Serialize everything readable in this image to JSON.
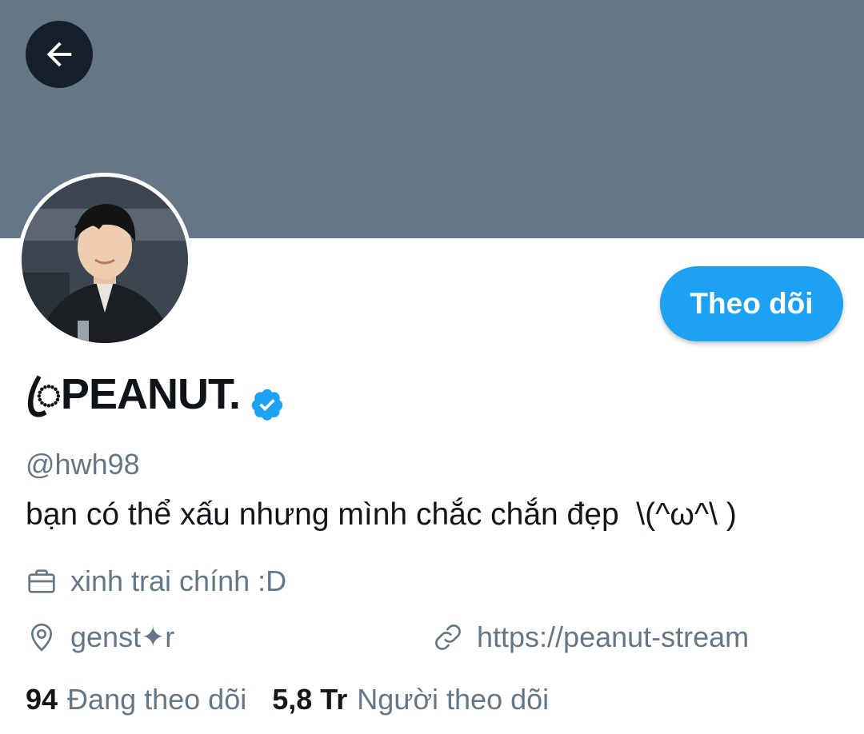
{
  "header": {
    "banner_color": "#657786",
    "back_icon": "arrow-left-icon"
  },
  "profile": {
    "display_name": "ꦿPEANUT.",
    "verified_icon": "verified-badge-icon",
    "handle": "@hwh98",
    "bio": "bạn có thể xấu nhưng mình chắc chắn đẹp  \\(^ω^\\ )",
    "follow_label": "Theo dõi",
    "job": "xinh trai chính :D",
    "location": "genst✦r",
    "url": "https://peanut-stream",
    "following_count": "94",
    "following_label": "Đang theo dõi",
    "followers_count": "5,8 Tr",
    "followers_label": "Người theo dõi"
  },
  "colors": {
    "accent": "#1da1f2",
    "secondary_text": "#657786"
  }
}
